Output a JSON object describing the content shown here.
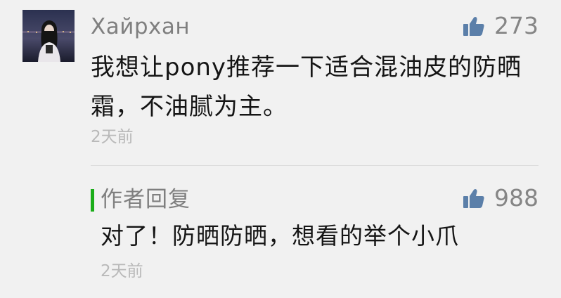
{
  "comment": {
    "username": "Хайрхан",
    "like_count": "273",
    "text": "我想让pony推荐一下适合混油皮的防晒霜，不油腻为主。",
    "timestamp": "2天前"
  },
  "reply": {
    "label": "作者回复",
    "like_count": "988",
    "text": "对了！防晒防晒，想看的举个小爪",
    "timestamp": "2天前"
  },
  "icons": {
    "like": "thumbs-up-icon",
    "avatar": "user-avatar"
  },
  "colors": {
    "background": "#f1f1f1",
    "like_icon": "#5b7fa9",
    "reply_accent": "#1aad19",
    "text_primary": "#151515",
    "text_secondary": "#7f7f7f",
    "timestamp": "#b9b9b9"
  }
}
